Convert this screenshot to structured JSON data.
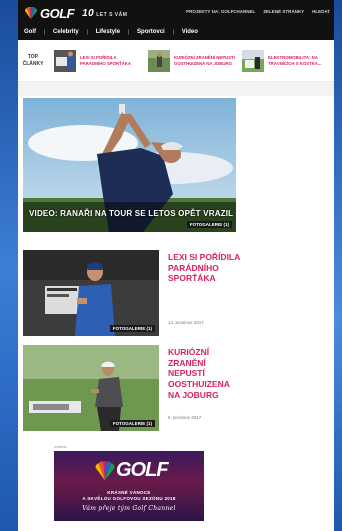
{
  "header": {
    "logo_text": "GOLF",
    "logo_tagline_number": "10",
    "logo_tagline": "LET S VÁM",
    "top_links": [
      "PROJEKTY NA: GOLFCHANNEL",
      "ZELENÉ STRÁNKY",
      "HLEDAT"
    ],
    "nav": [
      "Golf",
      "Celebrity",
      "Lifestyle",
      "Sportovci",
      "Video"
    ]
  },
  "top_stories": {
    "label_line1": "TOP",
    "label_line2": "ČLÁNKY",
    "items": [
      "LEXI SI POŘÍDILA PARÁDNÍHO SPORŤÁKA",
      "KURIÓZNÍ ZRANĚNÍ NEPUSTÍ OOSTHUIZENA NA JOBURG",
      "ELEKTROMOBILITA: NA TRÁVNÍCÍCH S KOSTKA..."
    ]
  },
  "hero": {
    "caption": "VIDEO: RANAŘI NA TOUR SE LETOS OPĚT VRAZIL",
    "badge": "FOTOGALERIE (1)"
  },
  "articles": [
    {
      "title": "LEXI SI POŘÍDILA PARÁDNÍHO SPORŤÁKA",
      "date": "14. prosince 2017",
      "badge": "FOTOGALERIE (1)"
    },
    {
      "title": "KURIÓZNÍ ZRANĚNÍ NEPUSTÍ OOSTHUIZENA NA JOBURG",
      "date": "6. prosince 2017",
      "badge": "FOTOGALERIE (1)"
    }
  ],
  "ad": {
    "label": "reklama",
    "logo_text": "GOLF",
    "line1": "KRÁSNÉ VÁNOCE",
    "line2": "A SKVĚLOU GOLFOVOU SEZÓNU 2018",
    "line3": "Vám přeje tým Golf Channel"
  },
  "colors": {
    "accent": "#d6245c",
    "header_bg": "#111111",
    "page_bg": "#2f6fc8"
  }
}
